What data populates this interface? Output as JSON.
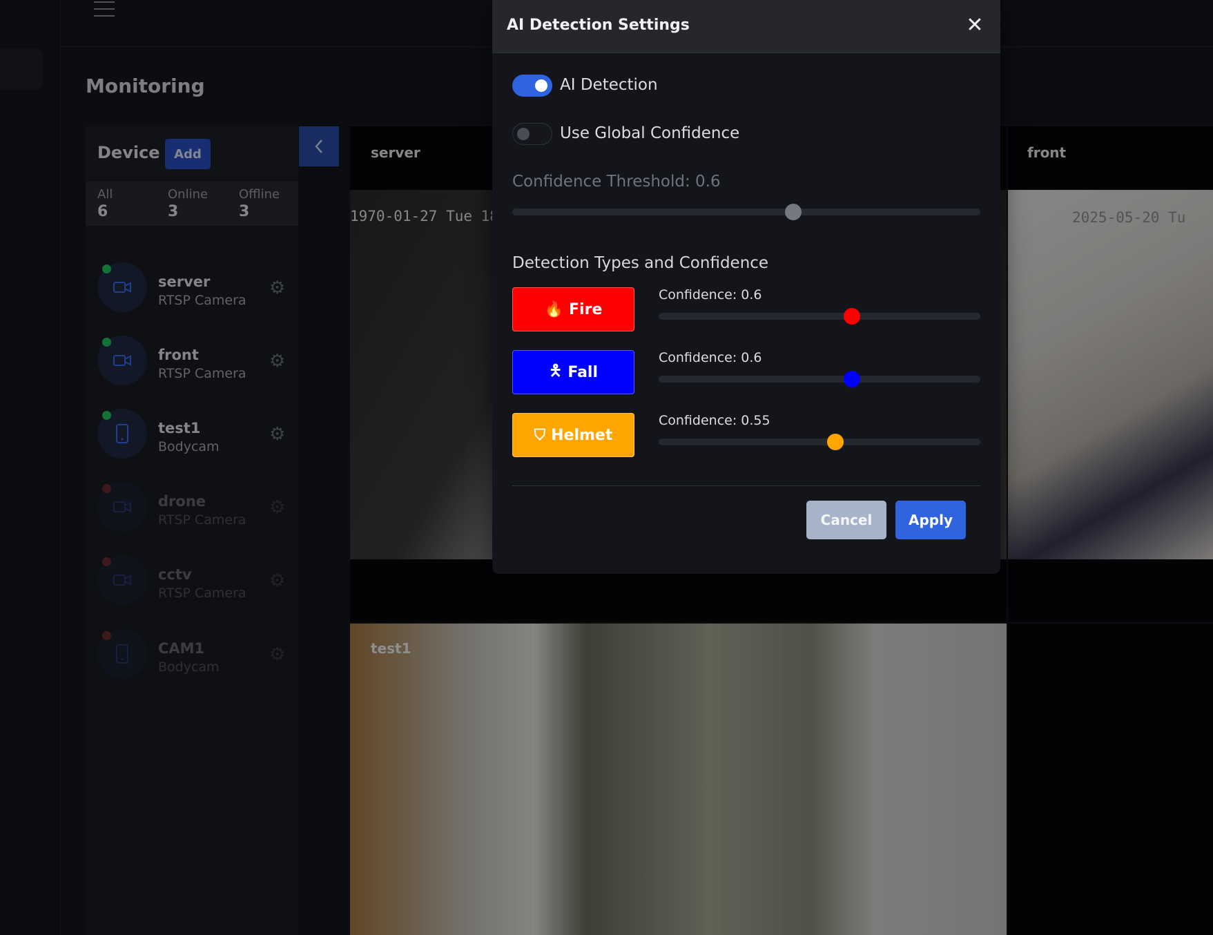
{
  "page": {
    "title": "Monitoring"
  },
  "devices": {
    "title": "Device",
    "add_label": "Add",
    "stats": [
      {
        "label": "All",
        "value": "6"
      },
      {
        "label": "Online",
        "value": "3"
      },
      {
        "label": "Offline",
        "value": "3"
      }
    ],
    "items": [
      {
        "name": "server",
        "type": "RTSP Camera",
        "status": "online",
        "icon": "video-camera-icon"
      },
      {
        "name": "front",
        "type": "RTSP Camera",
        "status": "online",
        "icon": "video-camera-icon"
      },
      {
        "name": "test1",
        "type": "Bodycam",
        "status": "online",
        "icon": "phone-icon"
      },
      {
        "name": "drone",
        "type": "RTSP Camera",
        "status": "offline",
        "icon": "video-camera-icon"
      },
      {
        "name": "cctv",
        "type": "RTSP Camera",
        "status": "offline",
        "icon": "video-camera-icon"
      },
      {
        "name": "CAM1",
        "type": "Bodycam",
        "status": "offline",
        "icon": "phone-icon"
      }
    ]
  },
  "tiles": {
    "server": {
      "label": "server",
      "timestamp": "1970-01-27 Tue 18"
    },
    "front": {
      "label": "front",
      "timestamp": "2025-05-20 Tu"
    },
    "test1": {
      "label": "test1"
    }
  },
  "modal": {
    "title": "AI Detection Settings",
    "close_icon": "close-icon",
    "ai_detection": {
      "label": "AI Detection",
      "enabled": true
    },
    "global_confidence": {
      "label": "Use Global Confidence",
      "enabled": false
    },
    "threshold": {
      "label": "Confidence Threshold: 0.6",
      "value": 0.6
    },
    "types_heading": "Detection Types and Confidence",
    "types": [
      {
        "label": "Fire",
        "icon": "fire-icon",
        "color": "#ff0000",
        "confidence_label": "Confidence: 0.6",
        "value": 0.6
      },
      {
        "label": "Fall",
        "icon": "person-falling-icon",
        "color": "#0000ff",
        "confidence_label": "Confidence: 0.6",
        "value": 0.6
      },
      {
        "label": "Helmet",
        "icon": "helmet-shield-icon",
        "color": "#ffa500",
        "confidence_label": "Confidence: 0.55",
        "value": 0.55
      }
    ],
    "cancel_label": "Cancel",
    "apply_label": "Apply"
  },
  "colors": {
    "accent": "#2f63e0",
    "online": "#22c55e",
    "offline": "#ef4444"
  }
}
